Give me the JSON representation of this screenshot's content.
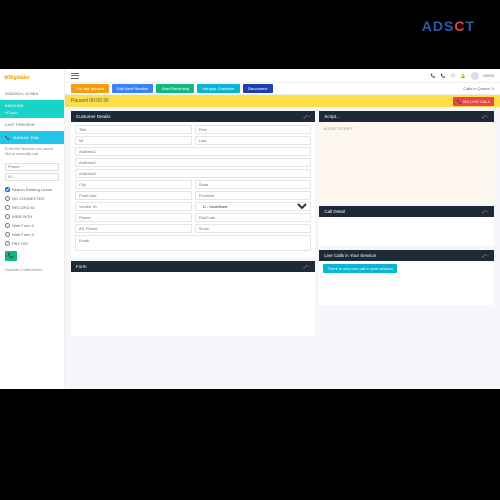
{
  "watermark": {
    "text1": "ADS",
    "text2": "C",
    "text3": "T"
  },
  "logo": "Bigdialer",
  "sidebar": {
    "date": "2/26/2024, 12:58:6",
    "inbound": {
      "label": "INBOUND",
      "sub": "MTupdo"
    },
    "preview": "LAST PREVIEW",
    "manual": "MANUAL DIAL",
    "hint": "Enter the Number you would like to manually call.",
    "phone_ph": "Phone",
    "code_ph": "91",
    "checks": [
      {
        "label": "Search Existing Leads",
        "checked": true
      },
      {
        "label": "NO CONNECTED",
        "checked": false
      },
      {
        "label": "RECORD ID:",
        "checked": false
      },
      {
        "label": "WEB PATH",
        "checked": false
      },
      {
        "label": "Web Form 2",
        "checked": false
      },
      {
        "label": "Web Form 3",
        "checked": false
      },
      {
        "label": "PBX OID",
        "checked": false
      }
    ],
    "bottom": "Sounds   Conferences"
  },
  "topbar": {
    "user": "10003"
  },
  "actions": {
    "b1": "You are paused",
    "b2": "Dial Next Number",
    "b3": "Start Recording",
    "b4": "Hangup Customer",
    "b5": "Disconnect",
    "queue": "Calls in Queue: 0"
  },
  "paused": {
    "label": "Paused 00:00:26",
    "nolive": "📞 NO LIVE CALL"
  },
  "panels": {
    "customer": "Customer Details",
    "script": "Script...",
    "form": "Form",
    "calldetail": "Call Detail",
    "session": "Live Calls in Your Session"
  },
  "customer": {
    "title": "Title",
    "first": "First",
    "mid": "MI",
    "last": "Last",
    "addr1": "Address1",
    "addr2": "Address2",
    "addr3": "Address3",
    "city": "City",
    "state": "State",
    "postcode": "PostCode",
    "province": "Province",
    "vendor": "Vendor ID",
    "gender": "Gender",
    "gender_val": "U - Undefined",
    "phone": "Phone",
    "altphone": "Alt. Phone",
    "dialcode": "DialCode",
    "show": "Show",
    "email": "Email"
  },
  "script": {
    "text": "AGENT SCRIPT"
  },
  "session": {
    "tag": "There is only one call in your session"
  }
}
